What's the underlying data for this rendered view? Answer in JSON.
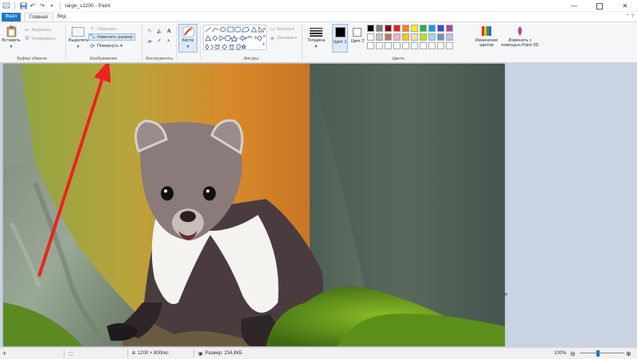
{
  "titlebar": {
    "title": "large_s1200 - Paint"
  },
  "tabs": {
    "file": "Файл",
    "home": "Главная",
    "view": "Вид"
  },
  "clipboard": {
    "paste": "Вставить",
    "cut": "Вырезать",
    "copy": "Копировать",
    "group_label": "Буфер обмена"
  },
  "image": {
    "select": "Выделить",
    "crop": "Обрезать",
    "resize": "Изменить размер",
    "rotate": "Повернуть",
    "group_label": "Изображение"
  },
  "tools": {
    "group_label": "Инструменты"
  },
  "brushes": {
    "label": "Кисти"
  },
  "shapes": {
    "outline": "Контур",
    "fill": "Заливка",
    "group_label": "Фигуры"
  },
  "size": {
    "label": "Толщина"
  },
  "colors": {
    "color1_label": "Цвет 1",
    "color2_label": "Цвет 2",
    "edit_colors": "Изменение цветов",
    "paint3d": "Изменить с помощью Paint 3D",
    "group_label": "Цвета",
    "color1": "#000000",
    "color2": "#ffffff",
    "palette_row1": [
      "#000000",
      "#7f7f7f",
      "#880015",
      "#ed1c24",
      "#ff7f27",
      "#fff200",
      "#22b14c",
      "#00a2e8",
      "#3f48cc",
      "#a349a4"
    ],
    "palette_row2": [
      "#ffffff",
      "#c3c3c3",
      "#b97a57",
      "#ffaec9",
      "#ffc90e",
      "#efe4b0",
      "#b5e61d",
      "#99d9ea",
      "#7092be",
      "#c8bfe7"
    ]
  },
  "statusbar": {
    "dimensions": "1200 × 800пкс",
    "filesize": "Размер: 234,8КБ",
    "zoom": "100%"
  }
}
